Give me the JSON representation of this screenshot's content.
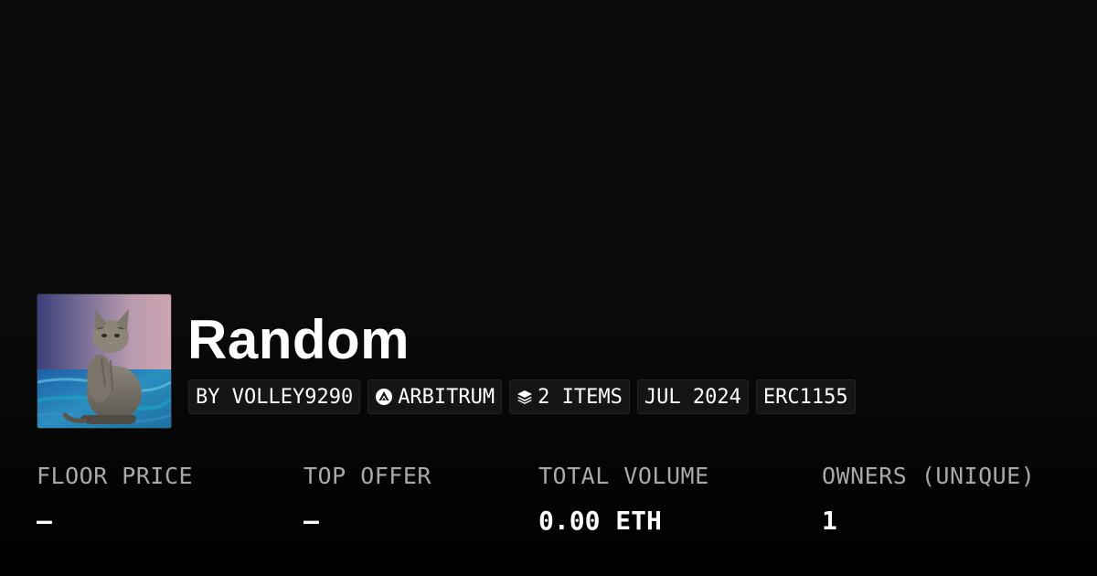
{
  "collection": {
    "name": "Random",
    "thumbnail_icon": "cat-photo",
    "creator": "BY VOLLEY9290",
    "chain": {
      "label": "ARBITRUM",
      "icon": "arbitrum-icon"
    },
    "items": {
      "label": "2 ITEMS",
      "icon": "layers-icon"
    },
    "created": "JUL 2024",
    "standard": "ERC1155"
  },
  "stats": [
    {
      "label": "FLOOR PRICE",
      "value": "–"
    },
    {
      "label": "TOP OFFER",
      "value": "–"
    },
    {
      "label": "TOTAL VOLUME",
      "value": "0.00 ETH"
    },
    {
      "label": "OWNERS (UNIQUE)",
      "value": "1"
    }
  ],
  "colors": {
    "background": "#0a0a0a",
    "badge_bg": "#151515",
    "label_gray": "#a9a9a9",
    "text": "#ffffff"
  }
}
